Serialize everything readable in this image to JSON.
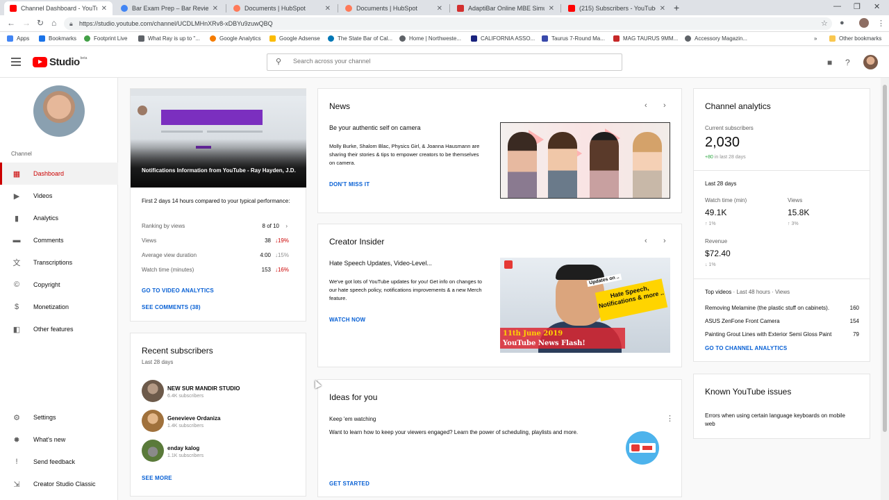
{
  "browser": {
    "tabs": [
      {
        "title": "Channel Dashboard - YouTube Studio",
        "color": "#ff0000"
      },
      {
        "title": "Bar Exam Prep – Bar Review Course",
        "color": "#4285f4"
      },
      {
        "title": "Documents | HubSpot",
        "color": "#ff7a59"
      },
      {
        "title": "Documents | HubSpot",
        "color": "#ff7a59"
      },
      {
        "title": "AdaptiBar Online MBE Simulator",
        "color": "#d32f2f"
      },
      {
        "title": "(215) Subscribers - YouTube",
        "color": "#ff0000"
      }
    ],
    "url": "https://studio.youtube.com/channel/UCDLMHnXRv8-xDBYu9zuwQBQ",
    "bookmarks": [
      {
        "label": "Apps",
        "color": "#4285f4"
      },
      {
        "label": "Bookmarks",
        "color": "#1a73e8"
      },
      {
        "label": "Footprint Live",
        "color": "#43a047"
      },
      {
        "label": "What Ray is up to \"...",
        "color": "#5f6368"
      },
      {
        "label": "Google Analytics",
        "color": "#f57c00"
      },
      {
        "label": "Google Adsense",
        "color": "#fbbc04"
      },
      {
        "label": "The State Bar of Cal...",
        "color": "#0077b5"
      },
      {
        "label": "Home | Northweste...",
        "color": "#5f6368"
      },
      {
        "label": "CALIFORNIA ASSO...",
        "color": "#1a237e"
      },
      {
        "label": "Taurus 7-Round Ma...",
        "color": "#3949ab"
      },
      {
        "label": "MAG TAURUS 9MM...",
        "color": "#c62828"
      },
      {
        "label": "Accessory Magazin...",
        "color": "#5f6368"
      }
    ],
    "other_bookmarks": "Other bookmarks"
  },
  "header": {
    "logo_text": "Studio",
    "logo_beta": "beta",
    "search_placeholder": "Search across your channel"
  },
  "sidebar": {
    "channel_label": "Channel",
    "items": [
      {
        "label": "Dashboard",
        "icon": "dashboard-icon",
        "glyph": "▦"
      },
      {
        "label": "Videos",
        "icon": "videos-icon",
        "glyph": "▶"
      },
      {
        "label": "Analytics",
        "icon": "analytics-icon",
        "glyph": "▮"
      },
      {
        "label": "Comments",
        "icon": "comments-icon",
        "glyph": "▬"
      },
      {
        "label": "Transcriptions",
        "icon": "transcriptions-icon",
        "glyph": "文"
      },
      {
        "label": "Copyright",
        "icon": "copyright-icon",
        "glyph": "©"
      },
      {
        "label": "Monetization",
        "icon": "monetization-icon",
        "glyph": "$"
      },
      {
        "label": "Other features",
        "icon": "other-features-icon",
        "glyph": "◧"
      }
    ],
    "bottom_items": [
      {
        "label": "Settings",
        "icon": "settings-icon",
        "glyph": "⚙"
      },
      {
        "label": "What's new",
        "icon": "whats-new-icon",
        "glyph": "✹"
      },
      {
        "label": "Send feedback",
        "icon": "feedback-icon",
        "glyph": "!"
      },
      {
        "label": "Creator Studio Classic",
        "icon": "classic-icon",
        "glyph": "⇲"
      }
    ]
  },
  "latest_video": {
    "title": "Notifications Information from YouTube - Ray Hayden, J.D.",
    "intro": "First 2 days 14 hours compared to your typical performance:",
    "ranking_label": "Ranking by views",
    "ranking_value": "8 of 10",
    "stats": [
      {
        "label": "Views",
        "value": "38",
        "arrow": "↓",
        "pct": "19%",
        "trend": "down"
      },
      {
        "label": "Average view duration",
        "value": "4:00",
        "arrow": "↓",
        "pct": "15%",
        "trend": "neutral"
      },
      {
        "label": "Watch time (minutes)",
        "value": "153",
        "arrow": "↓",
        "pct": "16%",
        "trend": "down"
      }
    ],
    "link_analytics": "GO TO VIDEO ANALYTICS",
    "link_comments": "SEE COMMENTS (38)"
  },
  "recent_subscribers": {
    "title": "Recent subscribers",
    "period": "Last 28 days",
    "items": [
      {
        "name": "NEW SUR MANDIR STUDIO",
        "count": "6.4K subscribers",
        "color": "#6d5a4a"
      },
      {
        "name": "Genevieve Ordaniza",
        "count": "1.4K subscribers",
        "color": "#a0713c"
      },
      {
        "name": "enday kalog",
        "count": "1.1K subscribers",
        "color": "#5a7a3a"
      }
    ],
    "see_more": "SEE MORE"
  },
  "news": {
    "title": "News",
    "headline": "Be your authentic self on camera",
    "body": "Molly Burke, Shalom Blac, Physics Girl, & Joanna Hausmann are sharing their stories & tips to empower creators to be themselves on camera.",
    "cta": "DON'T MISS IT"
  },
  "creator_insider": {
    "title": "Creator Insider",
    "headline": "Hate Speech Updates, Video-Level...",
    "body": "We've got lots of YouTube updates for you! Get info on changes to our hate speech policy, notifications improvements & a new Merch feature.",
    "cta": "WATCH NOW",
    "thumb_small": "Updates on ..",
    "thumb_sticker": "Hate Speech, Notifications & more ..",
    "thumb_date": "11th June 2019",
    "thumb_banner": "YouTube News Flash!"
  },
  "ideas": {
    "title": "Ideas for you",
    "subtitle": "Keep 'em watching",
    "body": "Want to learn how to keep your viewers engaged? Learn the power of scheduling, playlists and more.",
    "cta": "GET STARTED"
  },
  "analytics": {
    "title": "Channel analytics",
    "current_label": "Current subscribers",
    "current_value": "2,030",
    "delta_value": "+80",
    "delta_text": "in last 28 days",
    "period": "Last 28 days",
    "watch_label": "Watch time (min)",
    "watch_value": "49.1K",
    "watch_delta": "↑ 1%",
    "views_label": "Views",
    "views_value": "15.8K",
    "views_delta": "↑ 3%",
    "revenue_label": "Revenue",
    "revenue_value": "$72.40",
    "revenue_delta": "↓ 1%",
    "top_label": "Top videos",
    "top_meta": "· Last 48 hours · Views",
    "top_videos": [
      {
        "title": "Removing Melamine (the plastic stuff on cabinets).",
        "views": "160"
      },
      {
        "title": "ASUS ZenFone Front Camera",
        "views": "154"
      },
      {
        "title": "Painting Grout Lines with Exterior Semi Gloss Paint",
        "views": "79"
      }
    ],
    "cta": "GO TO CHANNEL ANALYTICS"
  },
  "known_issues": {
    "title": "Known YouTube issues",
    "body": "Errors when using certain language keyboards on mobile web"
  }
}
